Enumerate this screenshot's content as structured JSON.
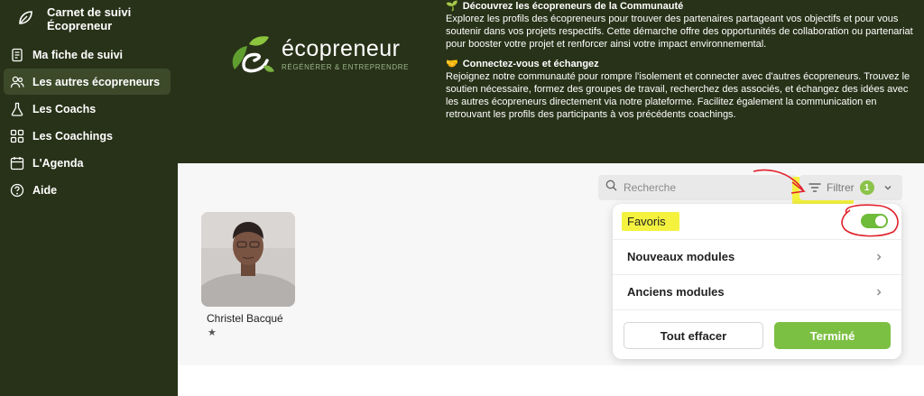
{
  "sidebar": {
    "title": "Carnet de suivi Écopreneur",
    "items": [
      {
        "label": "Ma fiche de suivi",
        "icon": "document-icon"
      },
      {
        "label": "Les autres écopreneurs",
        "icon": "users-icon",
        "active": true
      },
      {
        "label": "Les Coachs",
        "icon": "flask-icon"
      },
      {
        "label": "Les Coachings",
        "icon": "grid-icon"
      },
      {
        "label": "L'Agenda",
        "icon": "calendar-icon"
      },
      {
        "label": "Aide",
        "icon": "help-icon"
      }
    ]
  },
  "banner": {
    "logo_word": "écopreneur",
    "logo_tagline": "RÉGÉNÉRER & ENTREPRENDRE",
    "section1_title": "Découvrez les écopreneurs de la Communauté",
    "section1_text": "Explorez les profils des écopreneurs pour trouver des partenaires partageant vos objectifs et pour vous soutenir dans vos projets respectifs. Cette démarche offre des opportunités de collaboration ou partenariat pour booster votre projet et renforcer ainsi votre impact environnemental.",
    "section2_title": "Connectez-vous et échangez",
    "section2_text": "Rejoignez notre communauté pour rompre l'isolement et connecter avec d'autres écopreneurs. Trouvez le soutien nécessaire, formez des groupes de travail, recherchez des associés, et échangez des idées avec les autres écopreneurs directement via notre plateforme. Facilitez également la communication en retrouvant les profils des participants à vos précédents coachings."
  },
  "search": {
    "placeholder": "Recherche"
  },
  "filter": {
    "label": "Filtrer",
    "count": "1"
  },
  "people": [
    {
      "name": "Christel Bacqué",
      "favorite_mark": "★"
    }
  ],
  "dropdown": {
    "favoris": "Favoris",
    "favoris_on": true,
    "new_modules": "Nouveaux modules",
    "old_modules": "Anciens modules",
    "clear": "Tout effacer",
    "done": "Terminé"
  },
  "colors": {
    "sidebar_bg": "#283218",
    "accent_green": "#7cc043",
    "highlight_yellow": "#f4f23f",
    "annotation_red": "#e0202a"
  }
}
